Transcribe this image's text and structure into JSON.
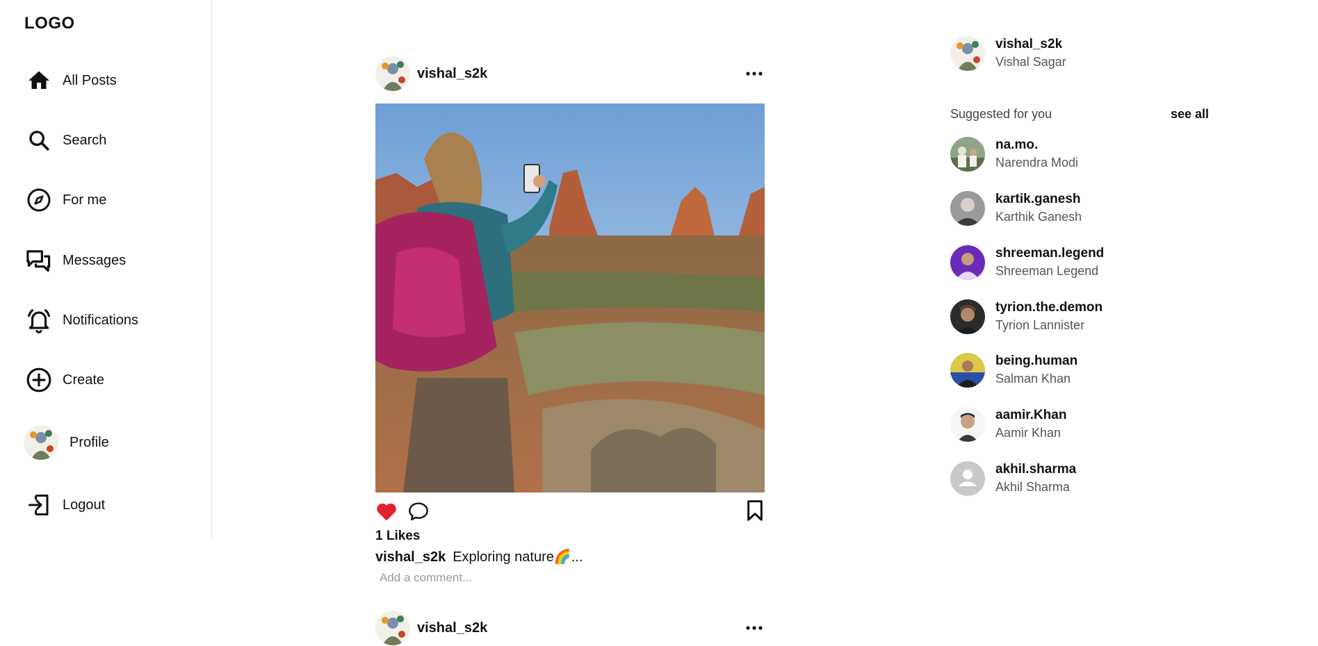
{
  "logo": "LOGO",
  "nav": {
    "all_posts": "All Posts",
    "search": "Search",
    "for_me": "For me",
    "messages": "Messages",
    "notifications": "Notifications",
    "create": "Create",
    "profile": "Profile",
    "logout": "Logout"
  },
  "posts": [
    {
      "username": "vishal_s2k",
      "likes": "1 Likes",
      "caption_user": "vishal_s2k",
      "caption_text": "Exploring nature🌈...",
      "comment_placeholder": "Add a comment...",
      "liked": true
    },
    {
      "username": "vishal_s2k"
    }
  ],
  "current_user": {
    "username": "vishal_s2k",
    "full_name": "Vishal Sagar"
  },
  "suggestions": {
    "heading": "Suggested for you",
    "see_all": "see all",
    "users": [
      {
        "username": "na.mo.",
        "full_name": "Narendra Modi"
      },
      {
        "username": "kartik.ganesh",
        "full_name": "Karthik Ganesh"
      },
      {
        "username": "shreeman.legend",
        "full_name": "Shreeman Legend"
      },
      {
        "username": "tyrion.the.demon",
        "full_name": "Tyrion Lannister"
      },
      {
        "username": "being.human",
        "full_name": "Salman Khan"
      },
      {
        "username": "aamir.Khan",
        "full_name": "Aamir Khan"
      },
      {
        "username": "akhil.sharma",
        "full_name": "Akhil Sharma"
      }
    ]
  },
  "colors": {
    "like_red": "#e0242f",
    "text": "#111111",
    "muted": "#555555",
    "divider": "#e3e3e3"
  },
  "icons": [
    "home-icon",
    "search-icon",
    "compass-icon",
    "messages-icon",
    "bell-icon",
    "plus-circle-icon",
    "logout-icon",
    "more-icon",
    "heart-icon",
    "comment-icon",
    "bookmark-icon",
    "default-avatar-icon"
  ]
}
